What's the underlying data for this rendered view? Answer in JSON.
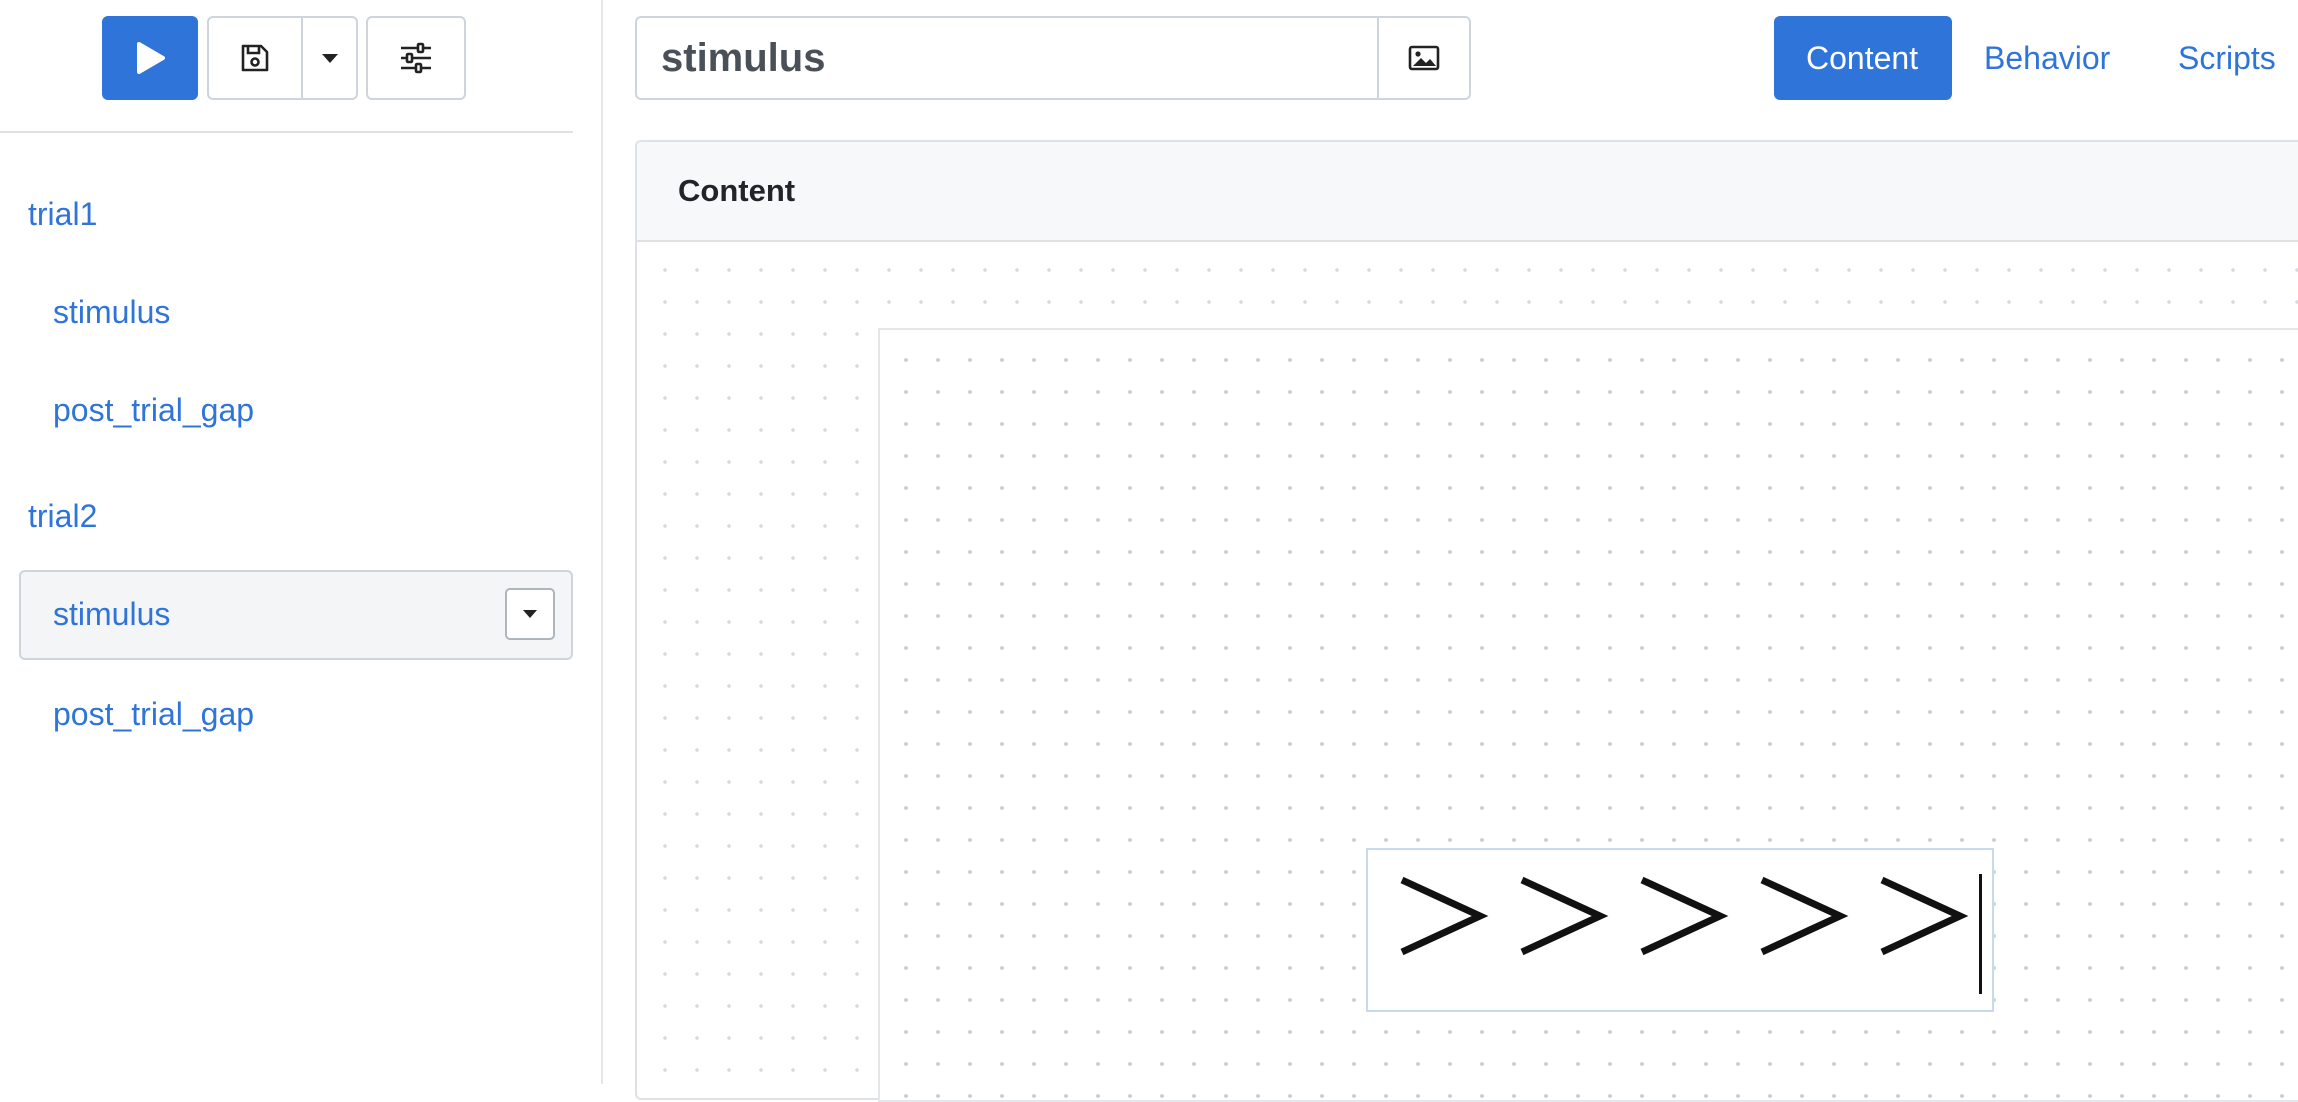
{
  "toolbar": {
    "run_icon": "play-icon",
    "save_icon": "floppy-disk-icon",
    "save_menu_icon": "caret-down-icon",
    "settings_icon": "sliders-icon"
  },
  "tree": {
    "nodes": [
      {
        "label": "trial1",
        "level": 0
      },
      {
        "label": "stimulus",
        "level": 1
      },
      {
        "label": "post_trial_gap",
        "level": 1
      },
      {
        "label": "trial2",
        "level": 0
      },
      {
        "label": "stimulus",
        "level": 1,
        "selected": true
      },
      {
        "label": "post_trial_gap",
        "level": 1
      }
    ]
  },
  "component": {
    "name": "stimulus",
    "image_button_icon": "image-icon"
  },
  "tabs": [
    {
      "label": "Content",
      "active": true
    },
    {
      "label": "Behavior",
      "active": false
    },
    {
      "label": "Scripts",
      "active": false
    }
  ],
  "content_panel": {
    "title": "Content",
    "stimulus_text": ">>>>>"
  },
  "colors": {
    "accent": "#2f74d8",
    "border": "#ced4da",
    "panel_header_bg": "#f7f8f9"
  }
}
